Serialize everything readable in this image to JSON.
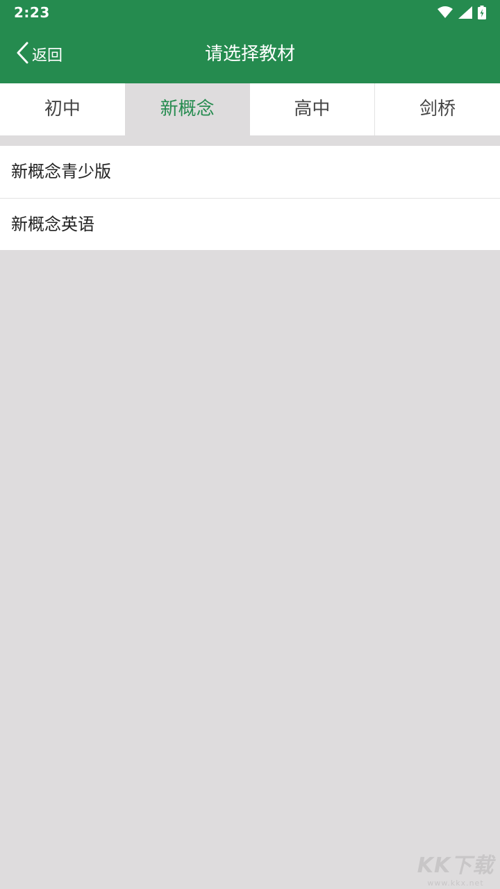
{
  "status_bar": {
    "time": "2:23",
    "icons": [
      "wifi-icon",
      "signal-icon",
      "battery-charging-icon"
    ]
  },
  "nav": {
    "back_label": "返回",
    "title": "请选择教材"
  },
  "tabs": [
    {
      "label": "初中",
      "active": false
    },
    {
      "label": "新概念",
      "active": true
    },
    {
      "label": "高中",
      "active": false
    },
    {
      "label": "剑桥",
      "active": false
    }
  ],
  "list": {
    "items": [
      {
        "label": "新概念青少版"
      },
      {
        "label": "新概念英语"
      }
    ]
  },
  "watermark": {
    "text": "KK下载",
    "url": "www.kkx.net"
  },
  "colors": {
    "header": "#258b4f",
    "accent": "#258b4f",
    "background": "#dedcdd"
  }
}
